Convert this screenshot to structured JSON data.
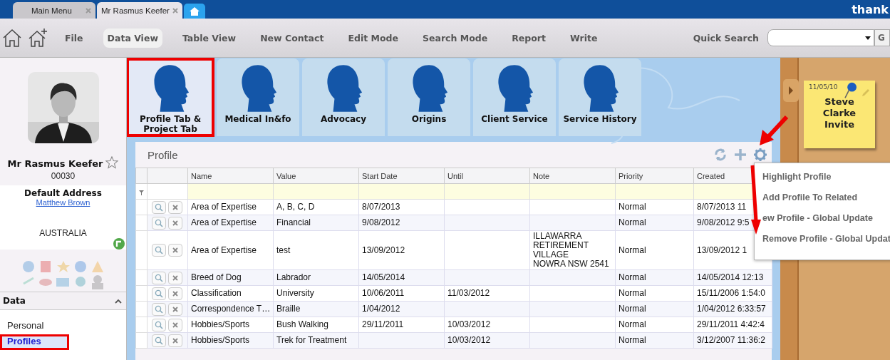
{
  "browser_tabs": [
    {
      "label": "Main Menu",
      "selected": false
    },
    {
      "label": "Mr Rasmus Keefer",
      "selected": true
    }
  ],
  "brand": "thank",
  "menu": [
    {
      "label": "File",
      "selected": false
    },
    {
      "label": "Data View",
      "selected": true
    },
    {
      "label": "Table View",
      "selected": false
    },
    {
      "label": "New Contact",
      "selected": false
    },
    {
      "label": "Edit Mode",
      "selected": false
    },
    {
      "label": "Search Mode",
      "selected": false
    },
    {
      "label": "Report",
      "selected": false
    },
    {
      "label": "Write",
      "selected": false
    }
  ],
  "quick_search": {
    "label": "Quick Search",
    "button": "G"
  },
  "contact": {
    "name": "Mr Rasmus Keefer",
    "favorite": false,
    "number": "00030",
    "address_title": "Default Address",
    "address_link": "Matthew Brown",
    "country": "AUSTRALIA"
  },
  "data_section": {
    "title": "Data",
    "expanded": true,
    "items": [
      {
        "label": "Personal",
        "selected": false,
        "highlighted": false
      },
      {
        "label": "Profiles",
        "selected": true,
        "highlighted": true
      }
    ]
  },
  "tiles": [
    {
      "label": "Profile Tab & Project Tab",
      "selected": true,
      "highlighted": true
    },
    {
      "label": "Medical In&fo",
      "selected": false,
      "highlighted": false
    },
    {
      "label": "Advocacy",
      "selected": false,
      "highlighted": false
    },
    {
      "label": "Origins",
      "selected": false,
      "highlighted": false
    },
    {
      "label": "Client Service",
      "selected": false,
      "highlighted": false
    },
    {
      "label": "Service History",
      "selected": false,
      "highlighted": false
    }
  ],
  "profile_panel": {
    "title": "Profile",
    "columns": [
      "Name",
      "Value",
      "Start Date",
      "Until",
      "Note",
      "Priority",
      "Created"
    ],
    "rows": [
      {
        "name": "Area of Expertise",
        "value": "A, B, C, D",
        "start_date": "8/07/2013",
        "priority": "Normal",
        "created": "8/07/2013 11"
      },
      {
        "name": "Area of Expertise",
        "value": "Financial",
        "start_date": "9/08/2012",
        "priority": "Normal",
        "created": "9/08/2012 9:5"
      },
      {
        "name": "Area of Expertise",
        "value": "test",
        "start_date": "13/09/2012",
        "note": "ILLAWARRA\nRETIREMENT\nVILLAGE\nNOWRA NSW 2541",
        "priority": "Normal",
        "created": "13/09/2012 1"
      },
      {
        "name": "Breed of Dog",
        "value": "Labrador",
        "start_date": "14/05/2014",
        "priority": "Normal",
        "created": "14/05/2014 12:13"
      },
      {
        "name": "Classification",
        "value": "University",
        "start_date": "10/06/2011",
        "until": "11/03/2012",
        "priority": "Normal",
        "created": "15/11/2006 1:54:0"
      },
      {
        "name": "Correspondence T…",
        "value": "Braille",
        "start_date": "1/04/2012",
        "priority": "Normal",
        "created": "1/04/2012 6:33:57"
      },
      {
        "name": "Hobbies/Sports",
        "value": "Bush Walking",
        "start_date": "29/11/2011",
        "until": "10/03/2012",
        "priority": "Normal",
        "created": "29/11/2011 4:42:4"
      },
      {
        "name": "Hobbies/Sports",
        "value": "Trek for Treatment",
        "until": "10/03/2012",
        "priority": "Normal",
        "created": "3/12/2007 11:36:2"
      }
    ]
  },
  "popup_menu": [
    "Highlight Profile",
    "Add Profile To Related",
    "ew Profile - Global Update",
    "Remove Profile - Global Updat"
  ],
  "sticky_note": {
    "date": "11/05/10",
    "text": "Steve Clarke Invite"
  }
}
